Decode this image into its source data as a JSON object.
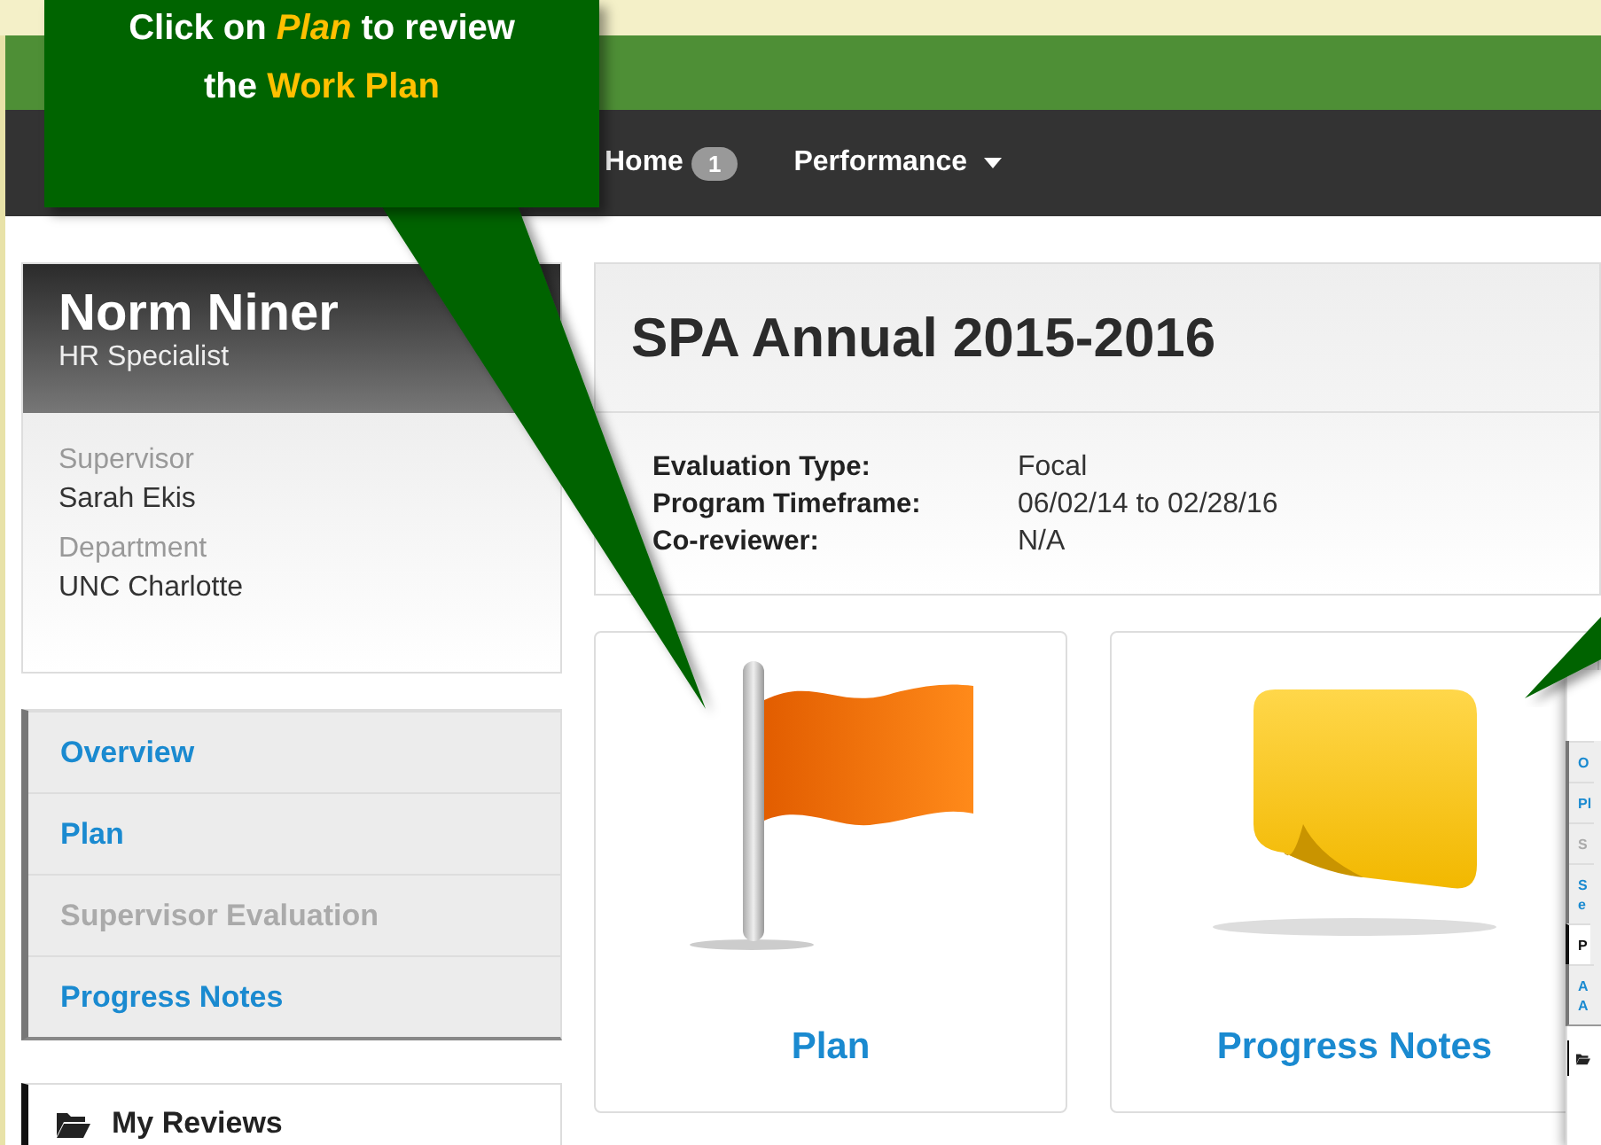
{
  "callout": {
    "segments": [
      {
        "text": "Click on ",
        "highlight": false,
        "italic": false
      },
      {
        "text": "Plan",
        "highlight": true,
        "italic": true
      },
      {
        "text": " to review the ",
        "highlight": false,
        "italic": false
      },
      {
        "text": "Work Plan",
        "highlight": true,
        "italic": false
      }
    ]
  },
  "navbar": {
    "items": [
      {
        "label": "Home",
        "badge": "1",
        "dropdown": false
      },
      {
        "label": "Performance",
        "dropdown": true
      }
    ]
  },
  "profile": {
    "name": "Norm Niner",
    "title": "HR Specialist",
    "fields": [
      {
        "label": "Supervisor",
        "value": "Sarah Ekis"
      },
      {
        "label": "Department",
        "value": "UNC Charlotte"
      }
    ]
  },
  "sidebar": {
    "items": [
      {
        "label": "Overview",
        "disabled": false
      },
      {
        "label": "Plan",
        "disabled": false
      },
      {
        "label": "Supervisor Evaluation",
        "disabled": true
      },
      {
        "label": "Progress Notes",
        "disabled": false
      }
    ]
  },
  "reviews_panel": {
    "title": "My Reviews"
  },
  "review": {
    "title": "SPA Annual 2015-2016",
    "details": [
      {
        "label": "Evaluation Type:",
        "value": "Focal"
      },
      {
        "label": "Program Timeframe:",
        "value": "06/02/14 to 02/28/16"
      },
      {
        "label": "Co-reviewer:",
        "value": "N/A"
      }
    ]
  },
  "tiles": [
    {
      "label": "Plan",
      "kind": "flag"
    },
    {
      "label": "Progress Notes",
      "kind": "note"
    }
  ],
  "thumbnail": {
    "items": [
      {
        "text": "O",
        "kind": "link"
      },
      {
        "text": "Pl",
        "kind": "link"
      },
      {
        "text": "S",
        "kind": "disabled"
      },
      {
        "text": "Se",
        "kind": "link"
      },
      {
        "text": "P",
        "kind": "active"
      },
      {
        "text": "A A",
        "kind": "link"
      }
    ]
  }
}
